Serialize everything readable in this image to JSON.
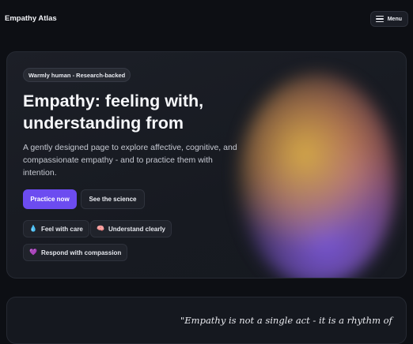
{
  "header": {
    "brand": "Empathy Atlas",
    "menu_label": "Menu",
    "menu_icon": "hamburger-icon"
  },
  "hero": {
    "tagline": "Warmly human - Research-backed",
    "title": "Empathy: feeling with, understanding from",
    "subtitle": "A gently designed page to explore affective, cognitive, and compassionate empathy - and to practice them with intention.",
    "primary_cta": "Practice now",
    "secondary_cta": "See the science",
    "chips": [
      {
        "icon": "💧",
        "icon_name": "droplet-icon",
        "label": "Feel with care"
      },
      {
        "icon": "🧠",
        "icon_name": "brain-icon",
        "label": "Understand clearly"
      },
      {
        "icon": "💜",
        "icon_name": "purple-heart-icon",
        "label": "Respond with compassion"
      }
    ]
  },
  "quote": {
    "text": "\"Empathy is not a single act - it is a rhythm of"
  },
  "colors": {
    "background": "#0d0f14",
    "accent": "#6c4cf0",
    "card": "#1c1f27"
  }
}
